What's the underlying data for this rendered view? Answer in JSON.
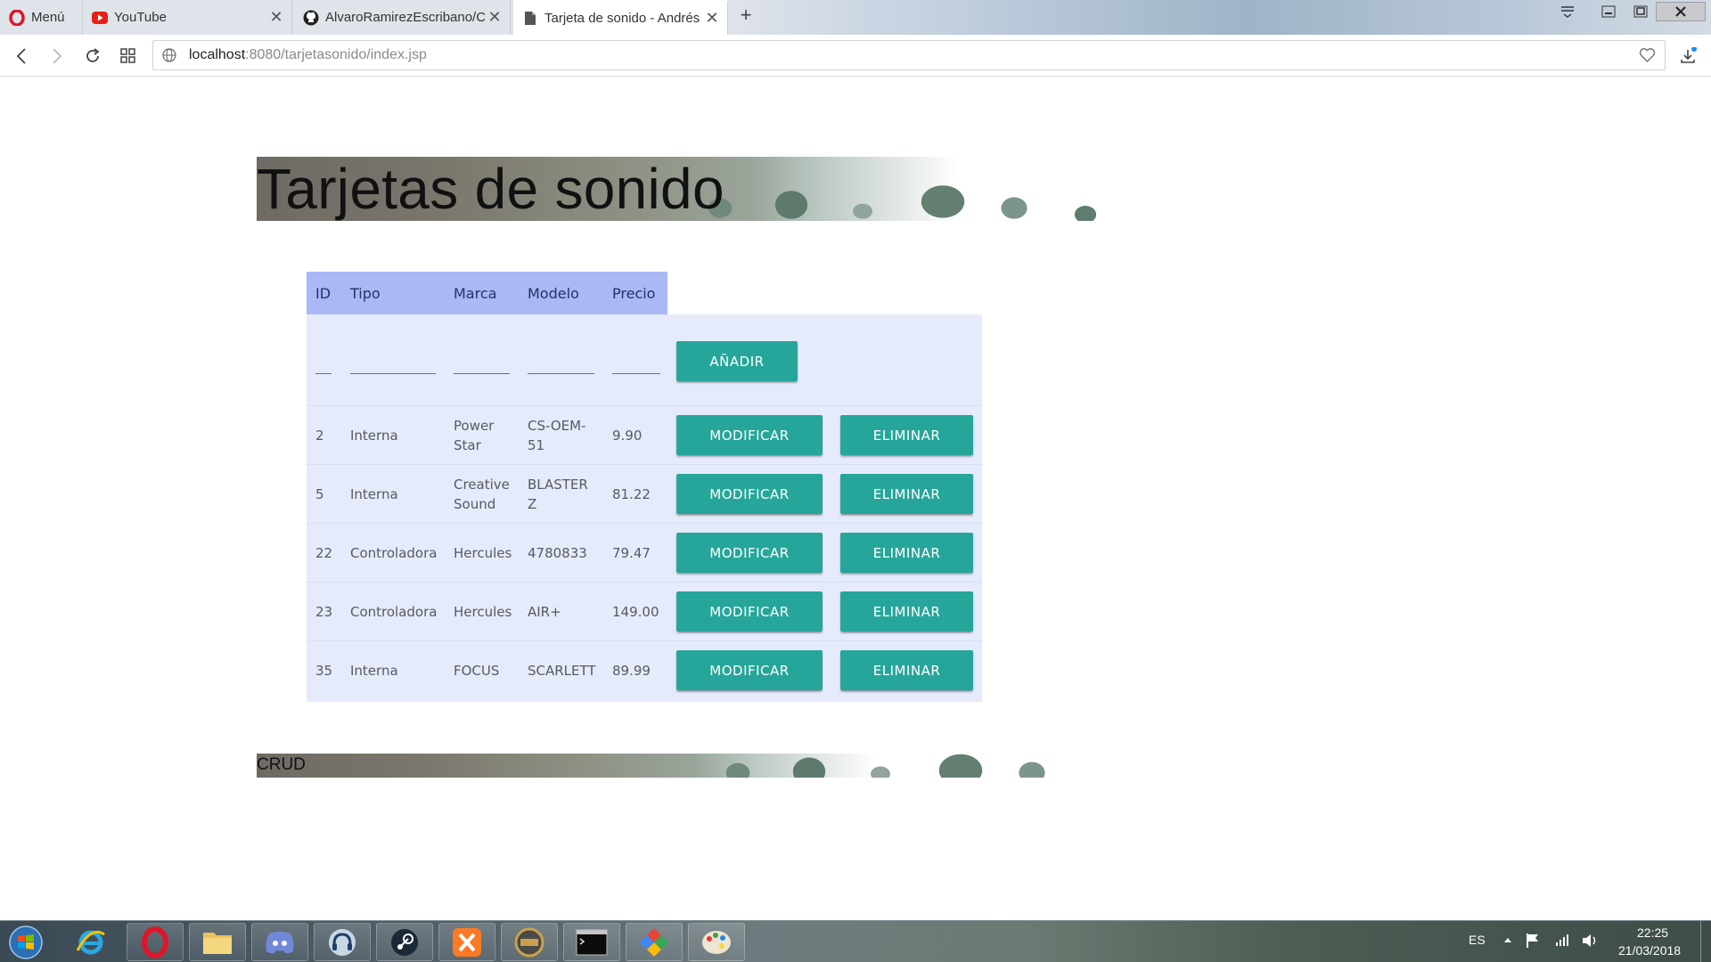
{
  "browser": {
    "tabs": [
      {
        "title": "Menú",
        "icon": "opera-icon"
      },
      {
        "title": "YouTube",
        "icon": "youtube-icon"
      },
      {
        "title": "AlvaroRamirezEscribano/C",
        "icon": "github-icon"
      },
      {
        "title": "Tarjeta de sonido - Andrés",
        "icon": "document-icon",
        "active": true
      }
    ],
    "url_host": "localhost",
    "url_rest": ":8080/tarjetasonido/index.jsp"
  },
  "page": {
    "title": "Tarjetas de sonido",
    "footer": "CRUD",
    "table": {
      "headers": [
        "ID",
        "Tipo",
        "Marca",
        "Modelo",
        "Precio"
      ],
      "add_button": "AÑADIR",
      "modify_button": "MODIFICAR",
      "delete_button": "ELIMINAR",
      "rows": [
        {
          "id": "2",
          "tipo": "Interna",
          "marca": "Power Star",
          "modelo": "CS-OEM-51",
          "precio": "9.90"
        },
        {
          "id": "5",
          "tipo": "Interna",
          "marca": "Creative Sound",
          "modelo": "BLASTER Z",
          "precio": "81.22"
        },
        {
          "id": "22",
          "tipo": "Controladora",
          "marca": "Hercules",
          "modelo": "4780833",
          "precio": "79.47"
        },
        {
          "id": "23",
          "tipo": "Controladora",
          "marca": "Hercules",
          "modelo": "AIR+",
          "precio": "149.00"
        },
        {
          "id": "35",
          "tipo": "Interna",
          "marca": "FOCUS",
          "modelo": "SCARLETT",
          "precio": "89.99"
        }
      ]
    }
  },
  "taskbar": {
    "apps": [
      "windows-start",
      "internet-explorer",
      "opera",
      "file-explorer",
      "discord",
      "teamspeak",
      "steam",
      "xampp",
      "java-ee-ide",
      "command-prompt",
      "app-launcher",
      "paint"
    ],
    "language": "ES",
    "time": "22:25",
    "date": "21/03/2018"
  },
  "colors": {
    "accent": "#26a69a",
    "table_header": "#aab8f6",
    "table_body": "#e6ebfc"
  }
}
